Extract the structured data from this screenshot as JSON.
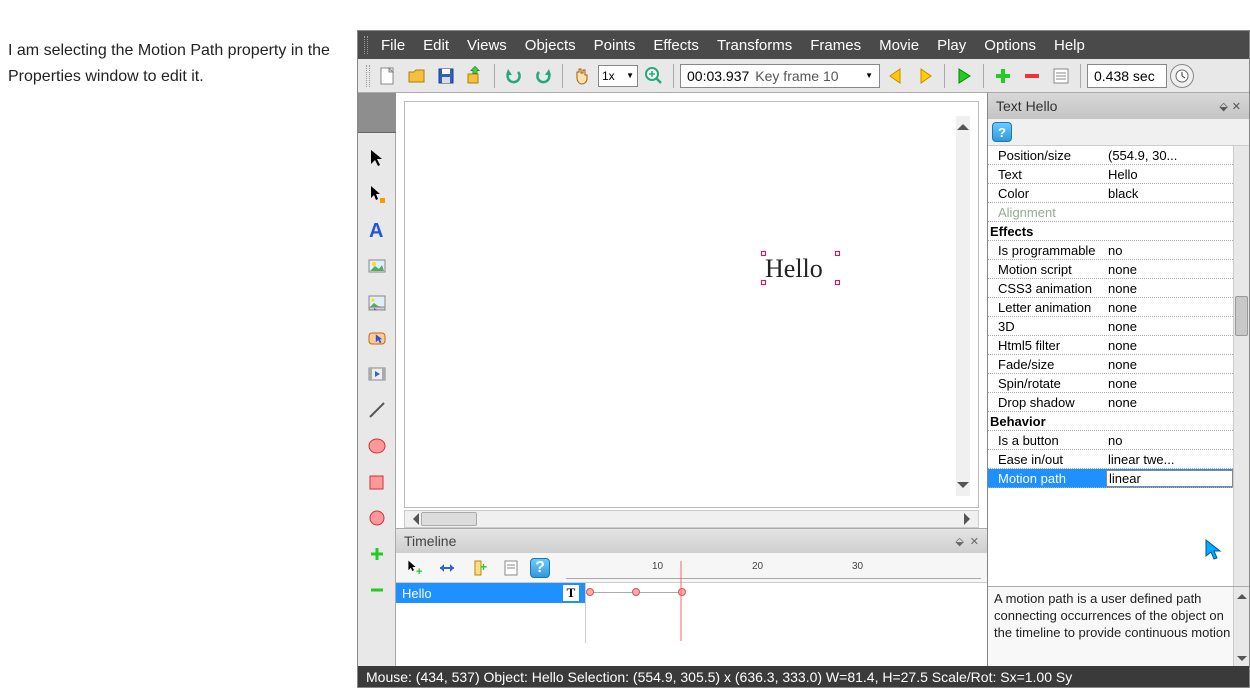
{
  "instruction": "I am selecting the Motion Path property in the Properties window to edit it.",
  "menus": [
    "File",
    "Edit",
    "Views",
    "Objects",
    "Points",
    "Effects",
    "Transforms",
    "Frames",
    "Movie",
    "Play",
    "Options",
    "Help"
  ],
  "toolbar": {
    "zoom": "1x",
    "time": "00:03.937",
    "keyframe_label": "Key frame 10",
    "duration": "0.438 sec"
  },
  "canvas": {
    "text": "Hello"
  },
  "timeline": {
    "title": "Timeline",
    "row_label": "Hello",
    "ruler_marks": [
      10,
      20,
      30
    ]
  },
  "properties": {
    "title": "Text Hello",
    "rows": [
      {
        "k": "Position/size",
        "v": "(554.9, 30...",
        "indent": true
      },
      {
        "k": "Text",
        "v": "Hello",
        "indent": true
      },
      {
        "k": "Color",
        "v": "black",
        "indent": true
      },
      {
        "k": "Alignment",
        "v": "",
        "indent": true,
        "disabled": true
      },
      {
        "k": "Effects",
        "v": "",
        "section": true
      },
      {
        "k": "Is programmable",
        "v": "no",
        "indent": true
      },
      {
        "k": "Motion script",
        "v": "none",
        "indent": true
      },
      {
        "k": "CSS3 animation",
        "v": "none",
        "indent": true
      },
      {
        "k": "Letter animation",
        "v": "none",
        "indent": true
      },
      {
        "k": "3D",
        "v": "none",
        "indent": true
      },
      {
        "k": "Html5 filter",
        "v": "none",
        "indent": true
      },
      {
        "k": "Fade/size",
        "v": "none",
        "indent": true
      },
      {
        "k": "Spin/rotate",
        "v": "none",
        "indent": true
      },
      {
        "k": "Drop shadow",
        "v": "none",
        "indent": true
      },
      {
        "k": "Behavior",
        "v": "",
        "section": true
      },
      {
        "k": "Is a button",
        "v": "no",
        "indent": true
      },
      {
        "k": "Ease in/out",
        "v": "linear twe...",
        "indent": true
      },
      {
        "k": "Motion path",
        "v": "linear",
        "indent": true,
        "selected": true
      }
    ],
    "help_text": "A motion path is a user defined path connecting occurrences of the object on the timeline to provide continuous motion"
  },
  "status": "Mouse: (434, 537)   Object: Hello   Selection: (554.9, 305.5) x (636.3, 333.0)   W=81.4,   H=27.5   Scale/Rot: Sx=1.00 Sy"
}
